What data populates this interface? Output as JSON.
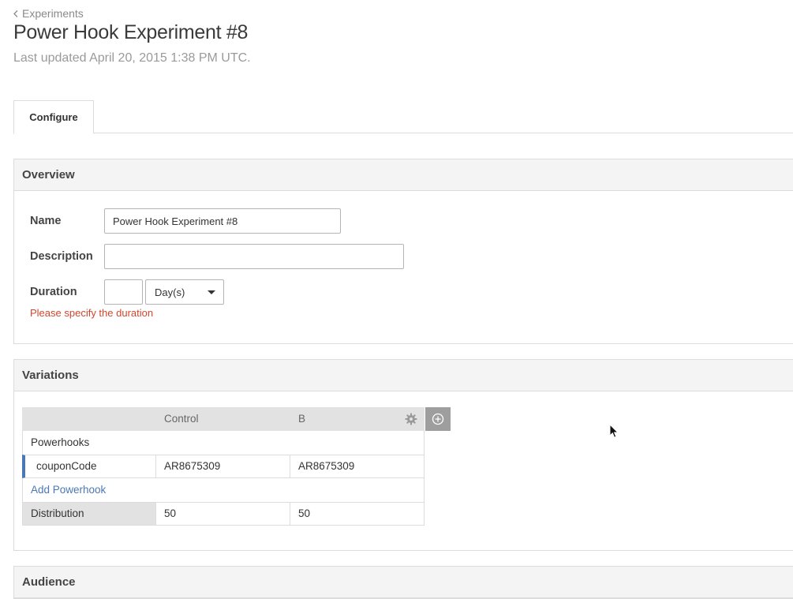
{
  "breadcrumb": {
    "label": "Experiments",
    "icon": "chevron-left-icon"
  },
  "page": {
    "title": "Power Hook Experiment #8",
    "last_updated": "Last updated April 20, 2015 1:38 PM UTC."
  },
  "tabs": [
    {
      "label": "Configure",
      "active": true
    }
  ],
  "overview": {
    "header": "Overview",
    "name_label": "Name",
    "name_value": "Power Hook Experiment #8",
    "description_label": "Description",
    "description_value": "",
    "duration_label": "Duration",
    "duration_value": "",
    "duration_unit": "Day(s)",
    "duration_error": "Please specify the duration"
  },
  "variations": {
    "header": "Variations",
    "columns": [
      "Control",
      "B"
    ],
    "section_label": "Powerhooks",
    "powerhooks": [
      {
        "name": "couponCode",
        "values": [
          "AR8675309",
          "AR8675309"
        ]
      }
    ],
    "add_powerhook_label": "Add Powerhook",
    "distribution_label": "Distribution",
    "distribution_values": [
      "50",
      "50"
    ],
    "icons": {
      "settings": "gear-icon",
      "add": "plus-circle-icon"
    }
  },
  "audience": {
    "header": "Audience"
  },
  "colors": {
    "accent": "#4a78b5",
    "error": "#d1462f",
    "panel_header_bg": "#f4f4f4",
    "table_header_bg": "#e2e2e2"
  }
}
